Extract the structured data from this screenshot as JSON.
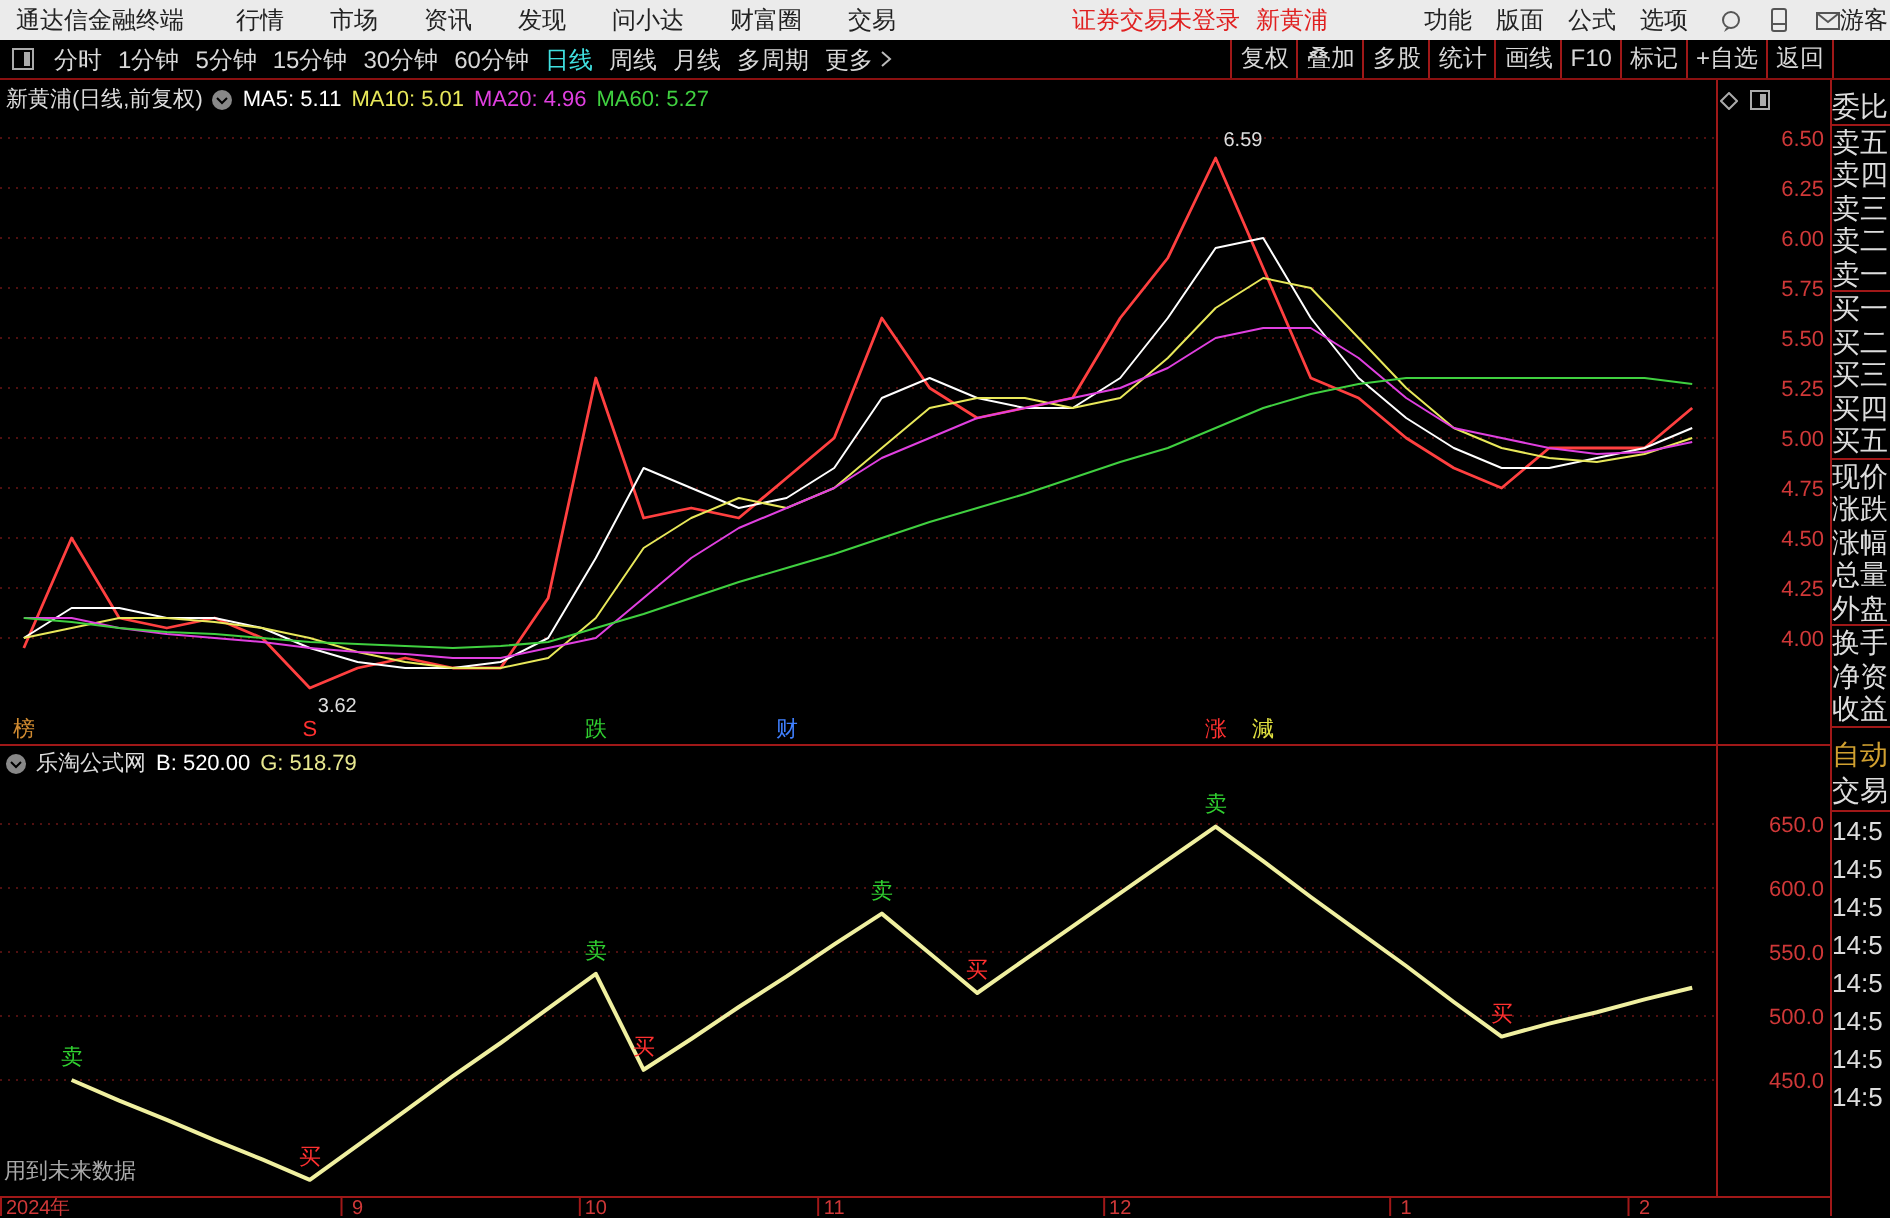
{
  "app": {
    "title": "通达信金融终端"
  },
  "menu": [
    "行情",
    "市场",
    "资讯",
    "发现",
    "问小达",
    "财富圈",
    "交易"
  ],
  "login_status": "证券交易未登录",
  "stock_link": "新黄浦",
  "right_menu": [
    "功能",
    "版面",
    "公式",
    "选项"
  ],
  "user": "游客",
  "periods": [
    {
      "label": "分时",
      "selected": false
    },
    {
      "label": "1分钟",
      "selected": false
    },
    {
      "label": "5分钟",
      "selected": false
    },
    {
      "label": "15分钟",
      "selected": false
    },
    {
      "label": "30分钟",
      "selected": false
    },
    {
      "label": "60分钟",
      "selected": false
    },
    {
      "label": "日线",
      "selected": true
    },
    {
      "label": "周线",
      "selected": false
    },
    {
      "label": "月线",
      "selected": false
    },
    {
      "label": "多周期",
      "selected": false
    },
    {
      "label": "更多",
      "selected": false
    }
  ],
  "tools": [
    "复权",
    "叠加",
    "多股",
    "统计",
    "画线",
    "F10",
    "标记",
    "+自选",
    "返回"
  ],
  "main_chart": {
    "header": "新黄浦(日线,前复权)",
    "indicators": [
      {
        "label": "MA5: 5.11",
        "color": "#ffffff"
      },
      {
        "label": "MA10: 5.01",
        "color": "#e8e85a"
      },
      {
        "label": "MA20: 4.96",
        "color": "#e040e0"
      },
      {
        "label": "MA60: 5.27",
        "color": "#40d040"
      }
    ],
    "chart_data": {
      "type": "line",
      "grid": true,
      "ylim": [
        3.47,
        6.79
      ],
      "categories": [
        null,
        null,
        null,
        null,
        null,
        null,
        null,
        null,
        null,
        null,
        null,
        null,
        null,
        null,
        null,
        null,
        null,
        null,
        null,
        null,
        null,
        null,
        null,
        null,
        null,
        null,
        null,
        null,
        null,
        null,
        null,
        null,
        null,
        null,
        null,
        null
      ],
      "yticks": [
        {
          "value": 4.0,
          "label": "4.00"
        },
        {
          "value": 4.25,
          "label": "4.25"
        },
        {
          "value": 4.5,
          "label": "4.50"
        },
        {
          "value": 4.75,
          "label": "4.75"
        },
        {
          "value": 5.0,
          "label": "5.00"
        },
        {
          "value": 5.25,
          "label": "5.25"
        },
        {
          "value": 5.5,
          "label": "5.50"
        },
        {
          "value": 5.75,
          "label": "5.75"
        },
        {
          "value": 6.0,
          "label": "6.00"
        },
        {
          "value": 6.25,
          "label": "6.25"
        },
        {
          "value": 6.5,
          "label": "6.50"
        }
      ],
      "series": [
        {
          "color": "#ff4040",
          "values": [
            3.95,
            4.5,
            4.1,
            4.05,
            4.1,
            4.0,
            3.75,
            3.85,
            3.9,
            3.85,
            3.85,
            4.2,
            5.3,
            4.6,
            4.65,
            4.6,
            4.8,
            5.0,
            5.6,
            5.25,
            5.1,
            5.15,
            5.2,
            5.6,
            5.9,
            6.4,
            5.85,
            5.3,
            5.2,
            5.0,
            4.85,
            4.75,
            4.95,
            4.95,
            4.95,
            5.15
          ]
        },
        {
          "color": "#ffffff",
          "values": [
            4.0,
            4.15,
            4.15,
            4.1,
            4.1,
            4.05,
            3.95,
            3.88,
            3.85,
            3.85,
            3.88,
            4.0,
            4.4,
            4.85,
            4.75,
            4.65,
            4.7,
            4.85,
            5.2,
            5.3,
            5.2,
            5.15,
            5.15,
            5.3,
            5.6,
            5.95,
            6.0,
            5.6,
            5.3,
            5.1,
            4.95,
            4.85,
            4.85,
            4.9,
            4.95,
            5.05
          ]
        },
        {
          "color": "#e8e85a",
          "values": [
            4.0,
            4.05,
            4.1,
            4.1,
            4.08,
            4.05,
            4.0,
            3.93,
            3.88,
            3.85,
            3.85,
            3.9,
            4.1,
            4.45,
            4.6,
            4.7,
            4.65,
            4.75,
            4.95,
            5.15,
            5.2,
            5.2,
            5.15,
            5.2,
            5.4,
            5.65,
            5.8,
            5.75,
            5.5,
            5.25,
            5.05,
            4.95,
            4.9,
            4.88,
            4.92,
            5.0
          ]
        },
        {
          "color": "#e040e0",
          "values": [
            4.1,
            4.1,
            4.05,
            4.02,
            4.0,
            3.98,
            3.95,
            3.93,
            3.92,
            3.9,
            3.9,
            3.95,
            4.0,
            4.2,
            4.4,
            4.55,
            4.65,
            4.75,
            4.9,
            5.0,
            5.1,
            5.15,
            5.2,
            5.25,
            5.35,
            5.5,
            5.55,
            5.55,
            5.4,
            5.2,
            5.05,
            5.0,
            4.95,
            4.92,
            4.93,
            4.98
          ]
        },
        {
          "color": "#40d040",
          "values": [
            4.1,
            4.08,
            4.05,
            4.03,
            4.02,
            4.0,
            3.98,
            3.97,
            3.96,
            3.95,
            3.96,
            3.98,
            4.05,
            4.12,
            4.2,
            4.28,
            4.35,
            4.42,
            4.5,
            4.58,
            4.65,
            4.72,
            4.8,
            4.88,
            4.95,
            5.05,
            5.15,
            5.22,
            5.27,
            5.3,
            5.3,
            5.3,
            5.3,
            5.3,
            5.3,
            5.27
          ]
        }
      ]
    },
    "price_labels": [
      {
        "text": "6.59",
        "kind": "high"
      },
      {
        "text": "3.62",
        "kind": "low"
      }
    ],
    "events": [
      {
        "text": "榜",
        "color": "#d08a30"
      },
      {
        "text": "S",
        "color": "#ff3030"
      },
      {
        "text": "跌",
        "color": "#30d030"
      },
      {
        "text": "财",
        "color": "#4080ff"
      },
      {
        "text": "涨",
        "color": "#ff3030"
      },
      {
        "text": "減",
        "color": "#e0e040"
      }
    ]
  },
  "indicator_chart": {
    "header": "乐淘公式网",
    "readings": [
      {
        "label": "B: 520.00",
        "color": "#ffffff"
      },
      {
        "label": "G: 518.79",
        "color": "#e8e890"
      }
    ],
    "note": "用到未来数据",
    "chart_data": {
      "type": "line",
      "grid": true,
      "ylim": [
        359.4,
        712.5
      ],
      "categories": [
        "2024年",
        null,
        null,
        null,
        null,
        null,
        null,
        "9",
        null,
        null,
        null,
        null,
        "10",
        null,
        null,
        null,
        null,
        "11",
        null,
        null,
        null,
        null,
        null,
        "12",
        null,
        null,
        null,
        null,
        null,
        "1",
        null,
        null,
        null,
        null,
        "2",
        null
      ],
      "yticks": [
        {
          "value": 450,
          "label": "450.0"
        },
        {
          "value": 500,
          "label": "500.0"
        },
        {
          "value": 550,
          "label": "550.0"
        },
        {
          "value": 600,
          "label": "600.0"
        },
        {
          "value": 650,
          "label": "650.0"
        }
      ],
      "series": [
        {
          "color": "#f0f0a0",
          "values": [
            null,
            450,
            434,
            419,
            403,
            388,
            372,
            399,
            426,
            453,
            479,
            506,
            533,
            458,
            482,
            507,
            531,
            556,
            580,
            549,
            518,
            544,
            570,
            596,
            622,
            648,
            621,
            593,
            566,
            539,
            511,
            484,
            494,
            503,
            513,
            522
          ]
        }
      ]
    },
    "signals": [
      {
        "kind": "sell",
        "text": "卖"
      },
      {
        "kind": "buy",
        "text": "买"
      },
      {
        "kind": "sell",
        "text": "卖"
      },
      {
        "kind": "buy",
        "text": "买"
      },
      {
        "kind": "sell",
        "text": "卖"
      },
      {
        "kind": "buy",
        "text": "买"
      },
      {
        "kind": "sell",
        "text": "卖"
      },
      {
        "kind": "buy",
        "text": "买"
      }
    ]
  },
  "quote_panel": {
    "groups": [
      [
        "委比"
      ],
      [
        "卖五",
        "卖四",
        "卖三",
        "卖二",
        "卖一"
      ],
      [
        "买一",
        "买二",
        "买三",
        "买四",
        "买五"
      ],
      [
        "现价",
        "涨跌",
        "涨幅",
        "总量",
        "外盘"
      ],
      [
        "换手",
        "净资",
        "收益"
      ]
    ],
    "auto": "自动",
    "trade": "交易",
    "times": [
      "14:5",
      "14:5",
      "14:5",
      "14:5",
      "14:5",
      "14:5",
      "14:5",
      "14:5"
    ]
  }
}
